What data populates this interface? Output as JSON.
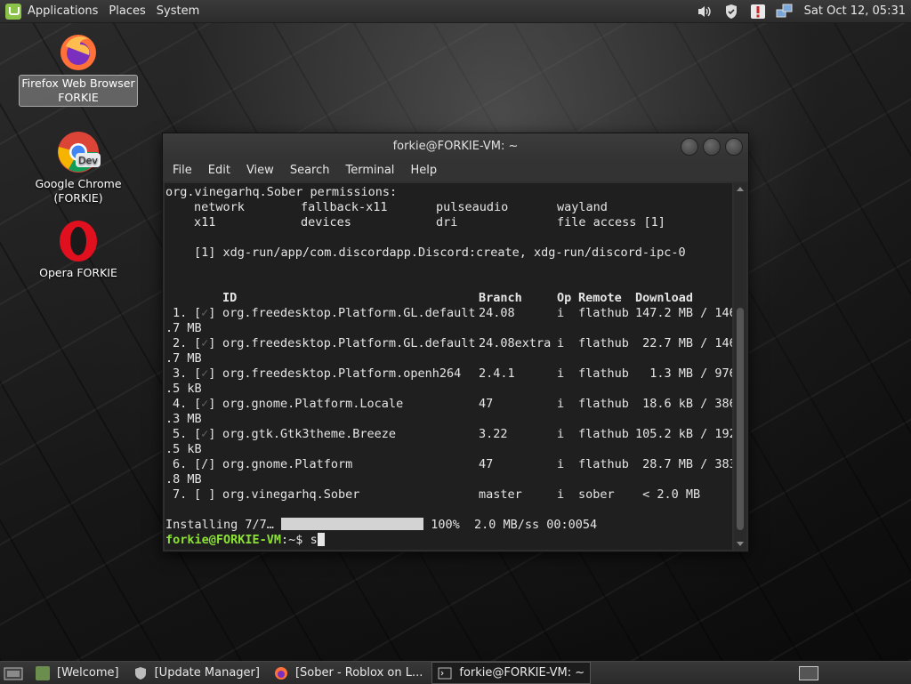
{
  "top_panel": {
    "menus": [
      "Applications",
      "Places",
      "System"
    ],
    "clock": "Sat Oct 12, 05:31"
  },
  "desktop_icons": [
    {
      "label_line1": "Firefox Web Browser",
      "label_line2": "FORKIE"
    },
    {
      "label_line1": "Google Chrome",
      "label_line2": "(FORKIE)",
      "badge": "Dev"
    },
    {
      "label_line1": "Opera FORKIE",
      "label_line2": ""
    }
  ],
  "terminal": {
    "title": "forkie@FORKIE-VM: ~",
    "menu": [
      "File",
      "Edit",
      "View",
      "Search",
      "Terminal",
      "Help"
    ],
    "permissions": {
      "header": "org.vinegarhq.Sober permissions:",
      "row1": [
        "network",
        "fallback-x11",
        "pulseaudio",
        "wayland"
      ],
      "row2": [
        "x11",
        "devices",
        "dri",
        "file access [1]"
      ],
      "footnote": "[1] xdg-run/app/com.discordapp.Discord:create, xdg-run/discord-ipc-0"
    },
    "table_headers": [
      "ID",
      "Branch",
      "Op",
      "Remote",
      "Download"
    ],
    "rows": [
      {
        "num": "1.",
        "mark": "✓",
        "id": "org.freedesktop.Platform.GL.default",
        "branch": "24.08",
        "op": "i",
        "remote": "flathub",
        "download": "147.2 MB / 146",
        "wrap": ".7 MB"
      },
      {
        "num": "2.",
        "mark": "✓",
        "id": "org.freedesktop.Platform.GL.default",
        "branch": "24.08extra",
        "op": "i",
        "remote": "flathub",
        "download": " 22.7 MB / 146",
        "wrap": ".7 MB"
      },
      {
        "num": "3.",
        "mark": "✓",
        "id": "org.freedesktop.Platform.openh264",
        "branch": "2.4.1",
        "op": "i",
        "remote": "flathub",
        "download": "  1.3 MB / 976",
        "wrap": ".5 kB"
      },
      {
        "num": "4.",
        "mark": "✓",
        "id": "org.gnome.Platform.Locale",
        "branch": "47",
        "op": "i",
        "remote": "flathub",
        "download": " 18.6 kB / 386",
        "wrap": ".3 MB"
      },
      {
        "num": "5.",
        "mark": "✓",
        "id": "org.gtk.Gtk3theme.Breeze",
        "branch": "3.22",
        "op": "i",
        "remote": "flathub",
        "download": "105.2 kB / 192",
        "wrap": ".5 kB"
      },
      {
        "num": "6.",
        "mark": "/",
        "id": "org.gnome.Platform",
        "branch": "47",
        "op": "i",
        "remote": "flathub",
        "download": " 28.7 MB / 383",
        "wrap": ".8 MB"
      },
      {
        "num": "7.",
        "mark": " ",
        "id": "org.vinegarhq.Sober",
        "branch": "master",
        "op": "i",
        "remote": "sober",
        "download": " < 2.0 MB",
        "wrap": ""
      }
    ],
    "progress": {
      "label": "Installing 7/7…",
      "value": 1.0,
      "status": "100%  2.0 MB/ss 00:0054"
    },
    "prompt": {
      "user": "forkie@FORKIE-VM",
      "path": ":~$",
      "input": "s"
    }
  },
  "taskbar": {
    "tasks": [
      {
        "label": "[Welcome]"
      },
      {
        "label": "[Update Manager]"
      },
      {
        "label": "[Sober - Roblox on L..."
      },
      {
        "label": "forkie@FORKIE-VM: ~"
      }
    ]
  }
}
